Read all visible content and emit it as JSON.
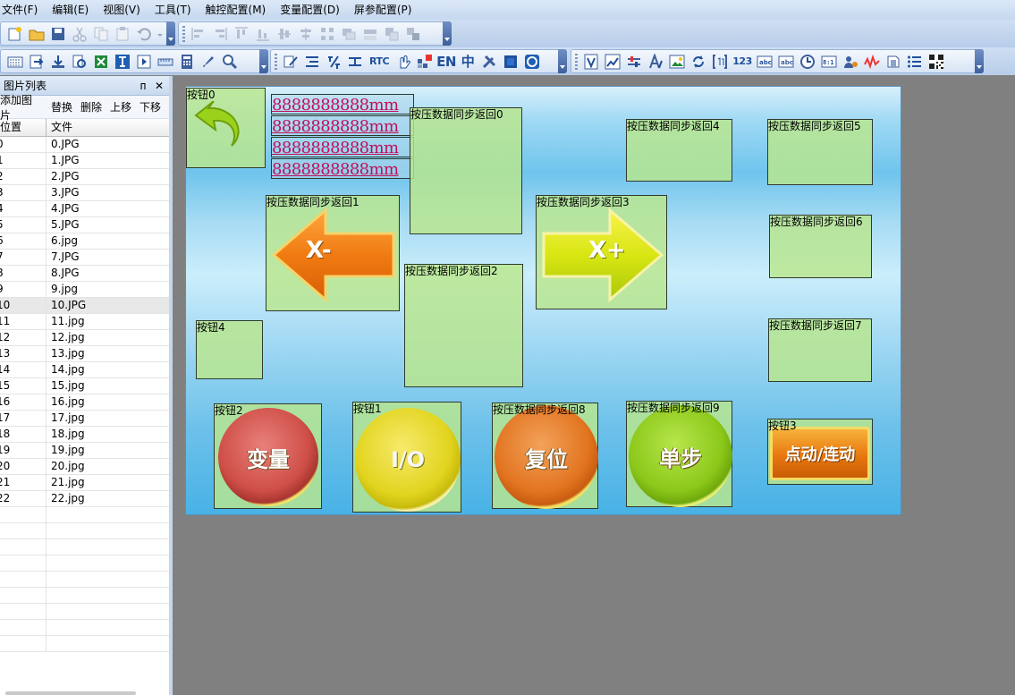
{
  "menu": [
    "文件(F)",
    "编辑(E)",
    "视图(V)",
    "工具(T)",
    "触控配置(M)",
    "变量配置(D)",
    "屏参配置(P)"
  ],
  "toolbar_text": {
    "rtc": "RTC",
    "en": "EN",
    "zh": "中",
    "num": "123"
  },
  "panel": {
    "title": "图片列表",
    "pin": "ᴨ",
    "close": "✕",
    "actions": [
      "添加图片",
      "替换",
      "删除",
      "上移",
      "下移"
    ],
    "col_pos": "位置",
    "col_file": "文件",
    "rows": [
      {
        "pos": "0",
        "file": "0.JPG"
      },
      {
        "pos": "1",
        "file": "1.JPG"
      },
      {
        "pos": "2",
        "file": "2.JPG"
      },
      {
        "pos": "3",
        "file": "3.JPG"
      },
      {
        "pos": "4",
        "file": "4.JPG"
      },
      {
        "pos": "5",
        "file": "5.JPG"
      },
      {
        "pos": "6",
        "file": "6.jpg"
      },
      {
        "pos": "7",
        "file": "7.JPG"
      },
      {
        "pos": "8",
        "file": "8.JPG"
      },
      {
        "pos": "9",
        "file": "9.jpg"
      },
      {
        "pos": "10",
        "file": "10.JPG"
      },
      {
        "pos": "11",
        "file": "11.jpg"
      },
      {
        "pos": "12",
        "file": "12.jpg"
      },
      {
        "pos": "13",
        "file": "13.jpg"
      },
      {
        "pos": "14",
        "file": "14.jpg"
      },
      {
        "pos": "15",
        "file": "15.jpg"
      },
      {
        "pos": "16",
        "file": "16.jpg"
      },
      {
        "pos": "17",
        "file": "17.jpg"
      },
      {
        "pos": "18",
        "file": "18.jpg"
      },
      {
        "pos": "19",
        "file": "19.jpg"
      },
      {
        "pos": "20",
        "file": "20.jpg"
      },
      {
        "pos": "21",
        "file": "21.jpg"
      },
      {
        "pos": "22",
        "file": "22.jpg"
      }
    ],
    "selected_index": 10
  },
  "canvas": {
    "num_value": "8888888888mm",
    "labels": {
      "btn0": "按钮0",
      "btn1": "按钮1",
      "btn2": "按钮2",
      "btn3": "按钮3",
      "btn4": "按钮4",
      "ret0": "按压数据同步返回0",
      "ret1": "按压数据同步返回1",
      "ret2": "按压数据同步返回2",
      "ret3": "按压数据同步返回3",
      "ret4": "按压数据同步返回4",
      "ret5": "按压数据同步返回5",
      "ret6": "按压数据同步返回6",
      "ret7": "按压数据同步返回7",
      "ret8": "按压数据同步返回8",
      "ret9": "按压数据同步返回9"
    },
    "art_text": {
      "x_minus": "X-",
      "x_plus": "X+",
      "variable": "变量",
      "io": "I/O",
      "reset": "复位",
      "step": "单步",
      "jog": "点动/连动"
    }
  },
  "colors": {
    "canvas_border": "#5d8fb8",
    "workspace": "#808080",
    "object_fill": "#bae68c",
    "numeric_text": "#c0105a"
  }
}
